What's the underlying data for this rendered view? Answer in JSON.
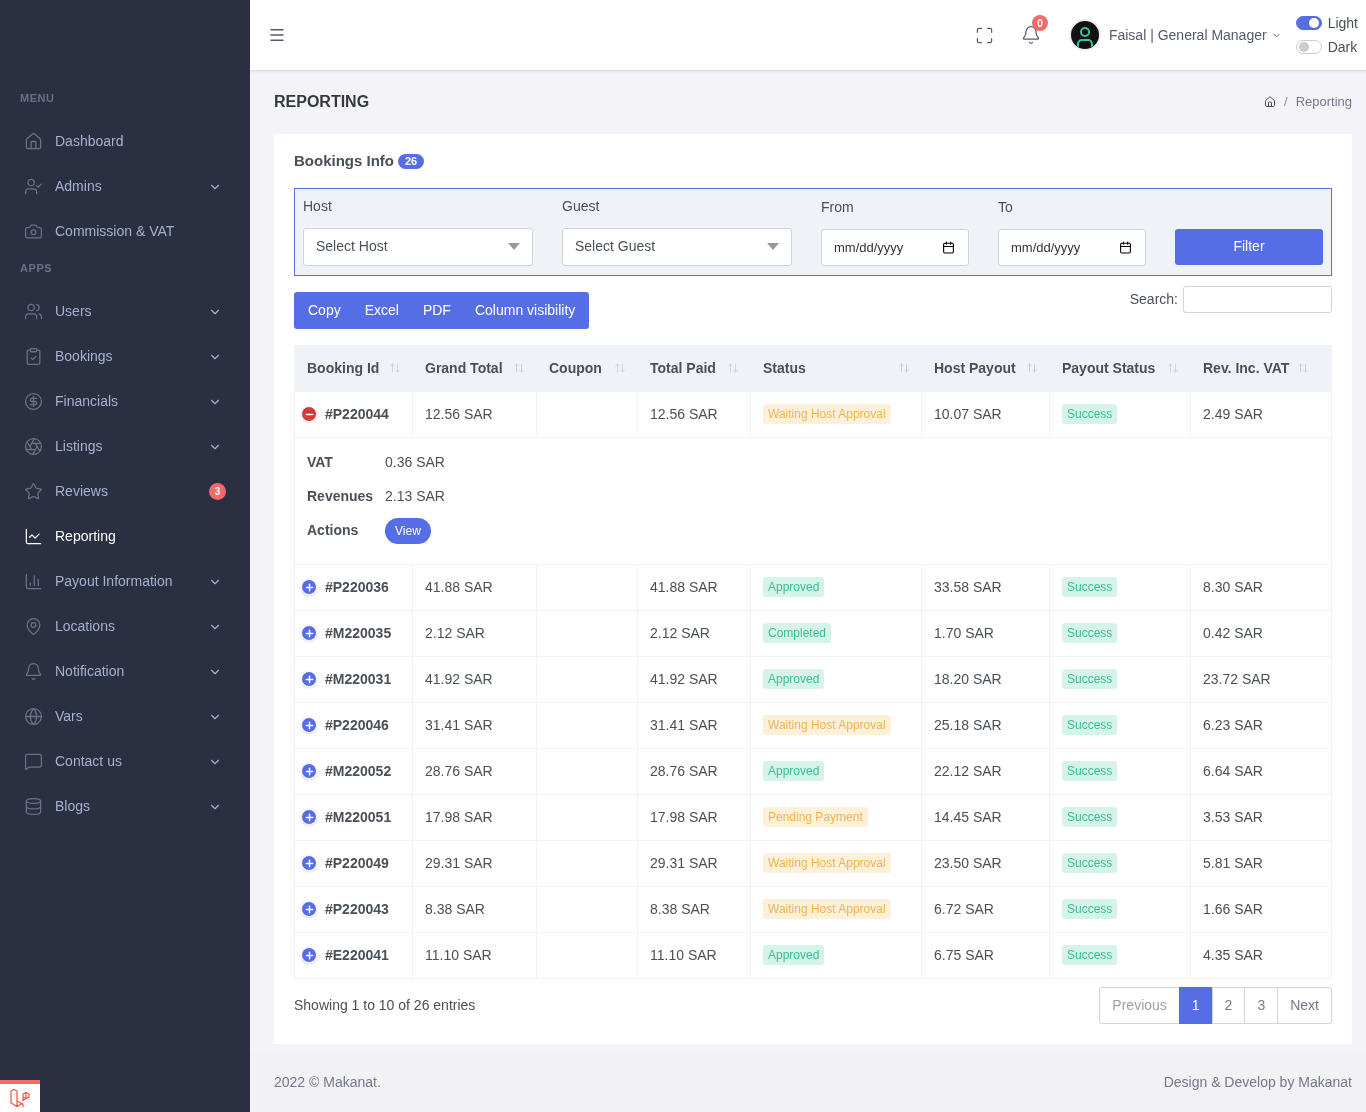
{
  "sidebar": {
    "sections": [
      {
        "title": "MENU",
        "items": [
          {
            "label": "Dashboard",
            "submenu": false,
            "selected": false
          },
          {
            "label": "Admins",
            "submenu": true,
            "selected": false
          },
          {
            "label": "Commission & VAT",
            "submenu": false,
            "selected": false
          }
        ]
      },
      {
        "title": "APPS",
        "items": [
          {
            "label": "Users",
            "submenu": true,
            "selected": false
          },
          {
            "label": "Bookings",
            "submenu": true,
            "selected": false
          },
          {
            "label": "Financials",
            "submenu": true,
            "selected": false
          },
          {
            "label": "Listings",
            "submenu": true,
            "selected": false
          },
          {
            "label": "Reviews",
            "submenu": false,
            "badge": "3",
            "selected": false
          },
          {
            "label": "Reporting",
            "submenu": false,
            "selected": true
          },
          {
            "label": "Payout Information",
            "submenu": true,
            "selected": false
          },
          {
            "label": "Locations",
            "submenu": true,
            "selected": false
          },
          {
            "label": "Notification",
            "submenu": true,
            "selected": false
          },
          {
            "label": "Vars",
            "submenu": true,
            "selected": false
          },
          {
            "label": "Contact us",
            "submenu": true,
            "selected": false
          },
          {
            "label": "Blogs",
            "submenu": true,
            "selected": false
          }
        ]
      }
    ]
  },
  "topbar": {
    "notification_count": "0",
    "user": "Faisal | General Manager",
    "theme": [
      {
        "label": "Light",
        "on": true
      },
      {
        "label": "Dark",
        "on": false
      }
    ]
  },
  "page": {
    "title": "REPORTING",
    "breadcrumb_separator": "/",
    "breadcrumb": [
      "Reporting"
    ]
  },
  "card": {
    "title": "Bookings Info",
    "count": "26",
    "filters": [
      {
        "kind": "select",
        "label": "Host",
        "placeholder": "Select Host"
      },
      {
        "kind": "select",
        "label": "Guest",
        "placeholder": "Select Guest"
      },
      {
        "kind": "date",
        "label": "From",
        "placeholder": "mm/dd/yyyy"
      },
      {
        "kind": "date",
        "label": "To",
        "placeholder": "mm/dd/yyyy"
      }
    ],
    "filter_button": "Filter",
    "export_buttons": [
      "Copy",
      "Excel",
      "PDF",
      "Column visibility"
    ],
    "search_label": "Search:",
    "columns": [
      "Booking Id",
      "Grand Total",
      "Coupon",
      "Total Paid",
      "Status",
      "Host Payout",
      "Payout Status",
      "Rev. Inc. VAT"
    ],
    "rows": [
      {
        "expanded": true,
        "booking_id": "#P220044",
        "grand_total": "12.56 SAR",
        "total_paid": "12.56 SAR",
        "status": {
          "text": "Waiting Host Approval",
          "kind": "warning"
        },
        "host_payout": "10.07 SAR",
        "payout_status": {
          "text": "Success",
          "kind": "success"
        },
        "rev": "2.49 SAR",
        "details": [
          {
            "label": "VAT",
            "value": "0.36 SAR"
          },
          {
            "label": "Revenues",
            "value": "2.13 SAR"
          },
          {
            "label": "Actions",
            "button": "View"
          }
        ]
      },
      {
        "expanded": false,
        "booking_id": "#P220036",
        "grand_total": "41.88 SAR",
        "total_paid": "41.88 SAR",
        "status": {
          "text": "Approved",
          "kind": "success"
        },
        "host_payout": "33.58 SAR",
        "payout_status": {
          "text": "Success",
          "kind": "success"
        },
        "rev": "8.30 SAR"
      },
      {
        "expanded": false,
        "booking_id": "#M220035",
        "grand_total": "2.12 SAR",
        "total_paid": "2.12 SAR",
        "status": {
          "text": "Completed",
          "kind": "success"
        },
        "host_payout": "1.70 SAR",
        "payout_status": {
          "text": "Success",
          "kind": "success"
        },
        "rev": "0.42 SAR"
      },
      {
        "expanded": false,
        "booking_id": "#M220031",
        "grand_total": "41.92 SAR",
        "total_paid": "41.92 SAR",
        "status": {
          "text": "Approved",
          "kind": "success"
        },
        "host_payout": "18.20 SAR",
        "payout_status": {
          "text": "Success",
          "kind": "success"
        },
        "rev": "23.72 SAR"
      },
      {
        "expanded": false,
        "booking_id": "#P220046",
        "grand_total": "31.41 SAR",
        "total_paid": "31.41 SAR",
        "status": {
          "text": "Waiting Host Approval",
          "kind": "warning"
        },
        "host_payout": "25.18 SAR",
        "payout_status": {
          "text": "Success",
          "kind": "success"
        },
        "rev": "6.23 SAR"
      },
      {
        "expanded": false,
        "booking_id": "#M220052",
        "grand_total": "28.76 SAR",
        "total_paid": "28.76 SAR",
        "status": {
          "text": "Approved",
          "kind": "success"
        },
        "host_payout": "22.12 SAR",
        "payout_status": {
          "text": "Success",
          "kind": "success"
        },
        "rev": "6.64 SAR"
      },
      {
        "expanded": false,
        "booking_id": "#M220051",
        "grand_total": "17.98 SAR",
        "total_paid": "17.98 SAR",
        "status": {
          "text": "Pending Payment",
          "kind": "warning"
        },
        "host_payout": "14.45 SAR",
        "payout_status": {
          "text": "Success",
          "kind": "success"
        },
        "rev": "3.53 SAR"
      },
      {
        "expanded": false,
        "booking_id": "#P220049",
        "grand_total": "29.31 SAR",
        "total_paid": "29.31 SAR",
        "status": {
          "text": "Waiting Host Approval",
          "kind": "warning"
        },
        "host_payout": "23.50 SAR",
        "payout_status": {
          "text": "Success",
          "kind": "success"
        },
        "rev": "5.81 SAR"
      },
      {
        "expanded": false,
        "booking_id": "#P220043",
        "grand_total": "8.38 SAR",
        "total_paid": "8.38 SAR",
        "status": {
          "text": "Waiting Host Approval",
          "kind": "warning"
        },
        "host_payout": "6.72 SAR",
        "payout_status": {
          "text": "Success",
          "kind": "success"
        },
        "rev": "1.66 SAR"
      },
      {
        "expanded": false,
        "booking_id": "#E220041",
        "grand_total": "11.10 SAR",
        "total_paid": "11.10 SAR",
        "status": {
          "text": "Approved",
          "kind": "success"
        },
        "host_payout": "6.75 SAR",
        "payout_status": {
          "text": "Success",
          "kind": "success"
        },
        "rev": "4.35 SAR"
      }
    ],
    "info": "Showing 1 to 10 of 26 entries",
    "pagination": [
      {
        "label": "Previous",
        "disabled": true,
        "selected": false
      },
      {
        "label": "1",
        "disabled": false,
        "selected": true
      },
      {
        "label": "2",
        "disabled": false,
        "selected": false
      },
      {
        "label": "3",
        "disabled": false,
        "selected": false
      },
      {
        "label": "Next",
        "disabled": false,
        "selected": false
      }
    ]
  },
  "footer": {
    "left": "2022 © Makanat.",
    "right": "Design & Develop by Makanat"
  }
}
